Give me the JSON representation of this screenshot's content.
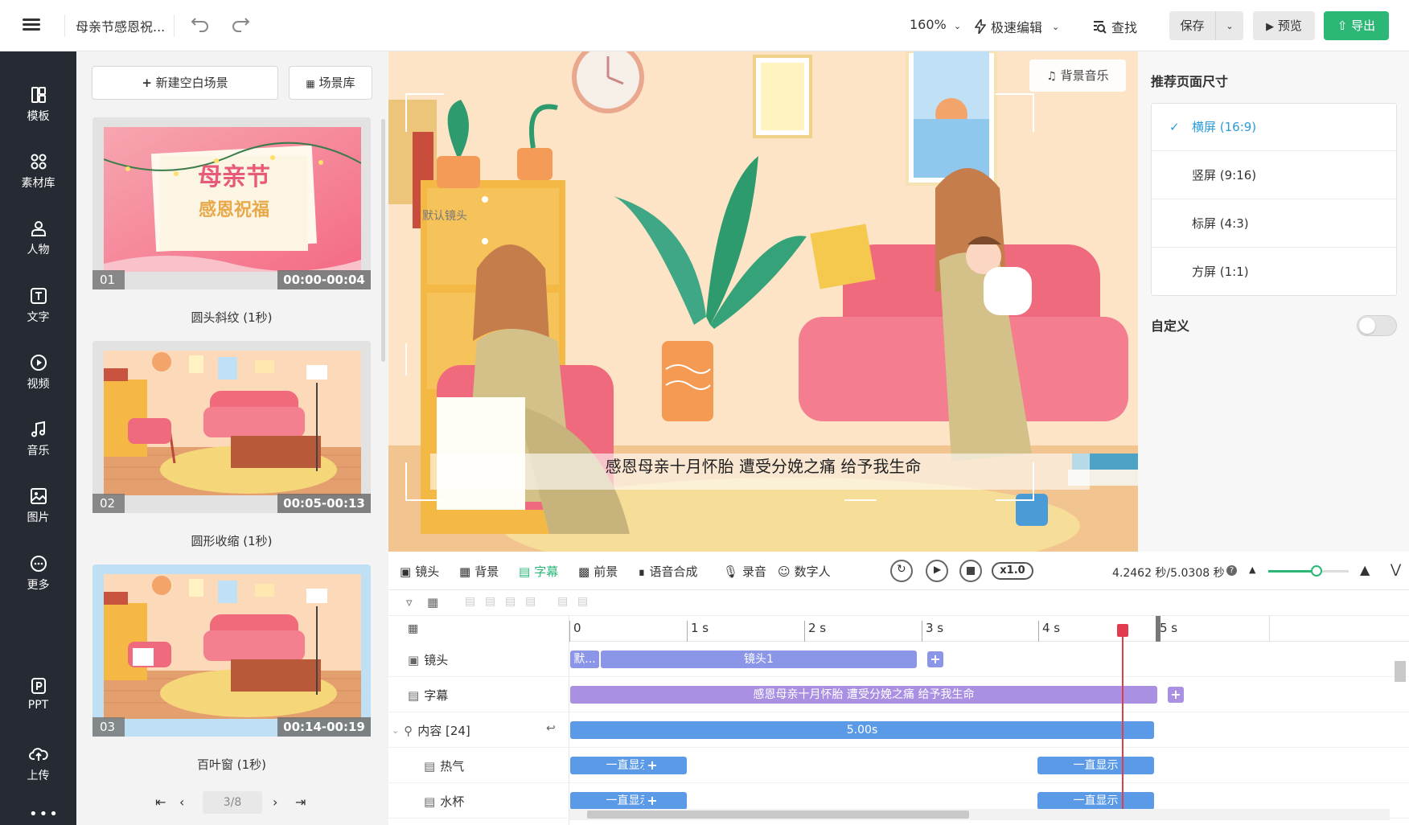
{
  "topbar": {
    "title": "母亲节感恩祝...",
    "zoom": "160%",
    "speed_edit": "极速编辑",
    "find": "查找",
    "save": "保存",
    "preview": "预览",
    "export": "导出"
  },
  "nav": {
    "items": [
      {
        "label": "模板",
        "icon": "template-icon"
      },
      {
        "label": "素材库",
        "icon": "assets-icon"
      },
      {
        "label": "人物",
        "icon": "person-icon"
      },
      {
        "label": "文字",
        "icon": "text-icon"
      },
      {
        "label": "视频",
        "icon": "video-icon"
      },
      {
        "label": "音乐",
        "icon": "music-icon"
      },
      {
        "label": "图片",
        "icon": "image-icon"
      },
      {
        "label": "更多",
        "icon": "more-icon"
      },
      {
        "label": "PPT",
        "icon": "ppt-icon"
      },
      {
        "label": "上传",
        "icon": "upload-icon"
      }
    ],
    "dots": "•••"
  },
  "scenes": {
    "new_blank": "新建空白场景",
    "library": "场景库",
    "cards": [
      {
        "num": "01",
        "time": "00:00-00:04",
        "name": "圆头斜纹 (1秒)",
        "title_text": "母亲节",
        "sub_text": "感恩祝福"
      },
      {
        "num": "02",
        "time": "00:05-00:13",
        "name": "圆形收缩 (1秒)"
      },
      {
        "num": "03",
        "time": "00:14-00:19",
        "name": "百叶窗 (1秒)"
      }
    ],
    "pager": {
      "page": "3/8"
    }
  },
  "canvas": {
    "bgm": "背景音乐",
    "camera_label": "默认镜头",
    "subtitle": "感恩母亲十月怀胎 遭受分娩之痛 给予我生命"
  },
  "right_panel": {
    "title": "推荐页面尺寸",
    "options": [
      {
        "label": "横屏 (16:9)",
        "selected": true
      },
      {
        "label": "竖屏 (9:16)",
        "selected": false
      },
      {
        "label": "标屏 (4:3)",
        "selected": false
      },
      {
        "label": "方屏 (1:1)",
        "selected": false
      }
    ],
    "custom": "自定义",
    "custom_enabled": false
  },
  "timeline_toolbar": {
    "tabs": [
      "镜头",
      "背景",
      "字幕",
      "前景",
      "语音合成",
      "录音",
      "数字人"
    ],
    "active_tab": "字幕",
    "speed": "x1.0",
    "time": "4.2462 秒/5.0308 秒",
    "help": "?",
    "zoom_level": 0.6
  },
  "timeline": {
    "ticks": [
      "0",
      "1 s",
      "2 s",
      "3 s",
      "4 s",
      "5 s"
    ],
    "rows": [
      {
        "name": "镜头",
        "clips": [
          "默...",
          "镜头1"
        ]
      },
      {
        "name": "字幕",
        "clips": [
          "感恩母亲十月怀胎 遭受分娩之痛 给予我生命"
        ]
      },
      {
        "name": "内容 [24]",
        "clips": [
          "5.00s"
        ]
      },
      {
        "name": "热气",
        "clips": [
          "一直显示",
          "一直显示"
        ]
      },
      {
        "name": "水杯",
        "clips": [
          "一直显示",
          "一直显示"
        ]
      }
    ],
    "add": "+"
  },
  "colors": {
    "accent_green": "#2cb777",
    "nav_bg": "#252a33",
    "selected_blue": "#2b9bd8",
    "playhead": "#e23b4d"
  }
}
